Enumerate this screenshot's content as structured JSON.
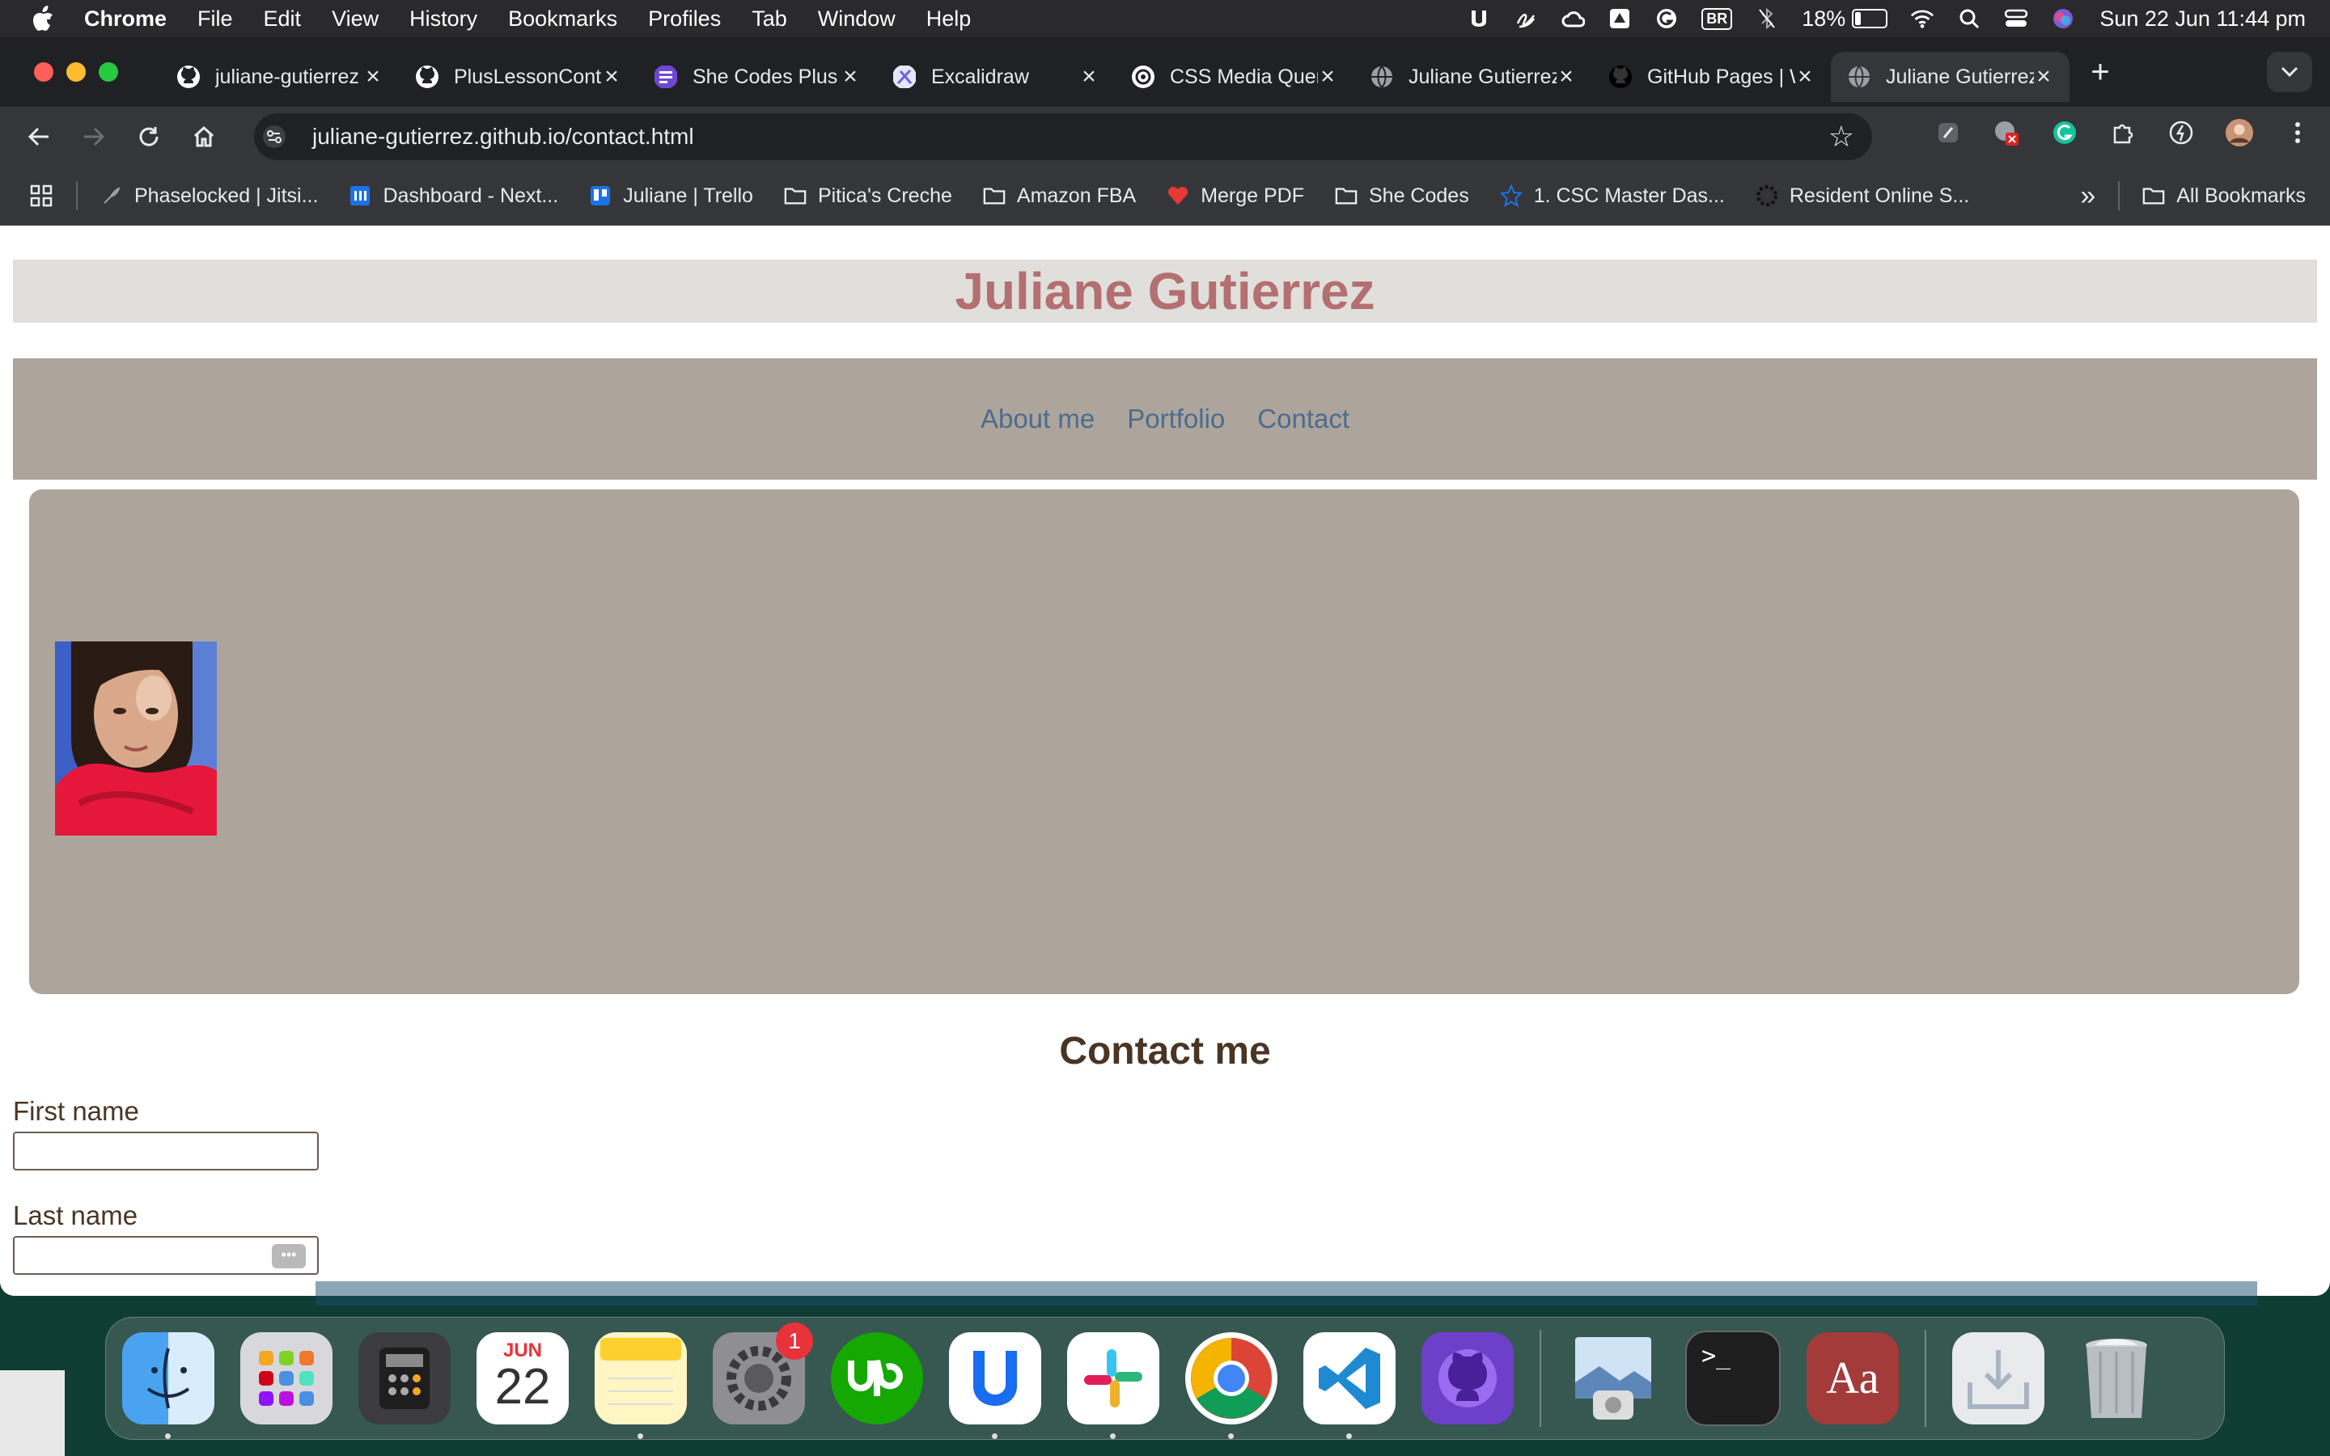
{
  "menubar": {
    "app": "Chrome",
    "items": [
      "File",
      "Edit",
      "View",
      "History",
      "Bookmarks",
      "Profiles",
      "Tab",
      "Window",
      "Help"
    ],
    "battery": "18%",
    "battery_level": 0.18,
    "input_badge": "BR",
    "clock": "Sun 22 Jun  11:44 pm"
  },
  "tabs": [
    {
      "title": "juliane-gutierrez",
      "icon": "github-icon"
    },
    {
      "title": "PlusLessonCont",
      "icon": "github-icon"
    },
    {
      "title": "She Codes Plus",
      "icon": "shecodes-icon"
    },
    {
      "title": "Excalidraw",
      "icon": "excalidraw-icon"
    },
    {
      "title": "CSS Media Queri",
      "icon": "openai-icon"
    },
    {
      "title": "Juliane Gutierrez",
      "icon": "globe-icon"
    },
    {
      "title": "GitHub Pages | W",
      "icon": "github-icon"
    },
    {
      "title": "Juliane Gutierrez",
      "icon": "globe-icon",
      "active": true
    }
  ],
  "toolbar": {
    "url": "juliane-gutierrez.github.io/contact.html"
  },
  "bookmarks": {
    "items": [
      {
        "label": "Phaselocked | Jitsi...",
        "icon": "feather-icon"
      },
      {
        "label": "Dashboard - Next...",
        "icon": "dashboard-icon"
      },
      {
        "label": "Juliane | Trello",
        "icon": "trello-icon"
      },
      {
        "label": "Pitica's Creche",
        "icon": "folder-icon"
      },
      {
        "label": "Amazon FBA",
        "icon": "folder-icon"
      },
      {
        "label": "Merge PDF",
        "icon": "heart-icon"
      },
      {
        "label": "She Codes",
        "icon": "folder-icon"
      },
      {
        "label": "1. CSC Master Das...",
        "icon": "star-icon"
      },
      {
        "label": "Resident Online S...",
        "icon": "gear-icon"
      }
    ],
    "overflow": "»",
    "all": "All Bookmarks"
  },
  "site": {
    "title": "Juliane Gutierrez",
    "nav": [
      "About me",
      "Portfolio",
      "Contact"
    ],
    "contact_heading": "Contact me",
    "form": {
      "first_name_label": "First name",
      "first_name_value": "",
      "last_name_label": "Last name",
      "last_name_value": ""
    }
  },
  "dock": {
    "settings_badge": "1",
    "calendar_month": "JUN",
    "calendar_day": "22",
    "apps": [
      "finder",
      "launchpad",
      "calculator",
      "calendar",
      "notes",
      "system-settings",
      "upwork",
      "linear",
      "slack",
      "chrome",
      "vscode",
      "github-desktop",
      "preview",
      "terminal",
      "dictionary",
      "downloads",
      "trash"
    ]
  },
  "colors": {
    "site_title": "#b46f70",
    "header_bg": "#e0dfdb",
    "nav_bg": "#ada59b",
    "nav_link": "#4c6b8f",
    "text": "#4a3525"
  }
}
